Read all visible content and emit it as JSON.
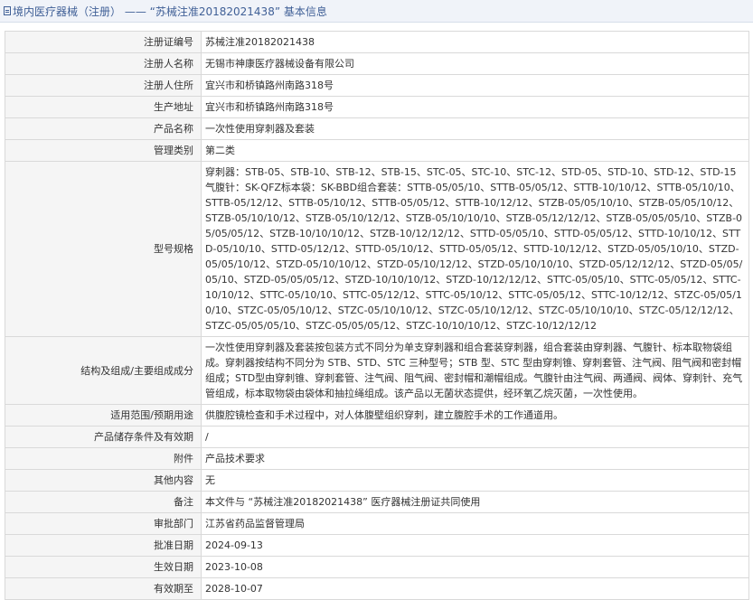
{
  "header": {
    "title": "境内医疗器械（注册） —— “苏械注准20182021438” 基本信息"
  },
  "rows": [
    {
      "label": "注册证编号",
      "value": "苏械注准20182021438"
    },
    {
      "label": "注册人名称",
      "value": "无锡市神康医疗器械设备有限公司"
    },
    {
      "label": "注册人住所",
      "value": "宜兴市和桥镇路州南路318号"
    },
    {
      "label": "生产地址",
      "value": "宜兴市和桥镇路州南路318号"
    },
    {
      "label": "产品名称",
      "value": "一次性使用穿刺器及套装"
    },
    {
      "label": "管理类别",
      "value": "第二类"
    },
    {
      "label": "型号规格",
      "value": "穿刺器：STB-05、STB-10、STB-12、STB-15、STC-05、STC-10、STC-12、STD-05、STD-10、STD-12、STD-15气腹针：SK-QFZ标本袋：SK-BBD组合套装：STTB-05/05/10、STTB-05/05/12、STTB-10/10/12、STTB-05/10/10、STTB-05/12/12、STTB-05/10/12、STTB-05/05/12、STTB-10/12/12、STZB-05/05/10/10、STZB-05/05/10/12、STZB-05/10/10/12、STZB-05/10/12/12、STZB-05/10/10/10、STZB-05/12/12/12、STZB-05/05/05/10、STZB-05/05/05/12、STZB-10/10/10/12、STZB-10/12/12/12、STTD-05/05/10、STTD-05/05/12、STTD-10/10/12、STTD-05/10/10、STTD-05/12/12、STTD-05/10/12、STTD-05/05/12、STTD-10/12/12、STZD-05/05/10/10、STZD-05/05/10/12、STZD-05/10/10/12、STZD-05/10/12/12、STZD-05/10/10/10、STZD-05/12/12/12、STZD-05/05/05/10、STZD-05/05/05/12、STZD-10/10/10/12、STZD-10/12/12/12、STTC-05/05/10、STTC-05/05/12、STTC-10/10/12、STTC-05/10/10、STTC-05/12/12、STTC-05/10/12、STTC-05/05/12、STTC-10/12/12、STZC-05/05/10/10、STZC-05/05/10/12、STZC-05/10/10/12、STZC-05/10/12/12、STZC-05/10/10/10、STZC-05/12/12/12、STZC-05/05/05/10、STZC-05/05/05/12、STZC-10/10/10/12、STZC-10/12/12/12"
    },
    {
      "label": "结构及组成/主要组成成分",
      "value": "一次性使用穿刺器及套装按包装方式不同分为单支穿刺器和组合套装穿刺器，组合套装由穿刺器、气腹针、标本取物袋组成。穿刺器按结构不同分为 STB、STD、STC 三种型号；STB 型、STC 型由穿刺锥、穿刺套管、注气阀、阻气阀和密封帽组成；STD型由穿刺锥、穿刺套管、注气阀、阻气阀、密封帽和潮帽组成。气腹针由注气阀、两通阀、阀体、穿刺针、充气管组成，标本取物袋由袋体和抽拉绳组成。该产品以无菌状态提供，经环氧乙烷灭菌，一次性使用。"
    },
    {
      "label": "适用范围/预期用途",
      "value": "供腹腔镜检查和手术过程中，对人体腹壁组织穿刺，建立腹腔手术的工作通道用。"
    },
    {
      "label": "产品储存条件及有效期",
      "value": "/"
    },
    {
      "label": "附件",
      "value": "产品技术要求"
    },
    {
      "label": "其他内容",
      "value": "无"
    },
    {
      "label": "备注",
      "value": "本文件与 “苏械注准20182021438” 医疗器械注册证共同使用"
    },
    {
      "label": "审批部门",
      "value": "江苏省药品监督管理局"
    },
    {
      "label": "批准日期",
      "value": "2024-09-13"
    },
    {
      "label": "生效日期",
      "value": "2023-10-08"
    },
    {
      "label": "有效期至",
      "value": "2028-10-07"
    }
  ]
}
